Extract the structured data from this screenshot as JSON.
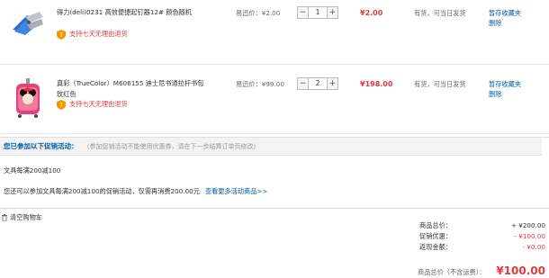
{
  "items": [
    {
      "name": "得力(deli)0231 高效便捷起钉器12# 颜色随机",
      "promise": "支持七天无理由退货",
      "price": "易迅价：¥2.00",
      "quantity": "1",
      "subtotal": "¥2.00",
      "stock": "有货，可当日发货",
      "op_save": "暂存收藏夹",
      "op_delete": "删除"
    },
    {
      "name": "真彩（TrueColor）M606155 迪士尼书通拉杆书包 玫红色",
      "promise": "支持七天无理由退货",
      "price": "易迅价：¥99.00",
      "quantity": "2",
      "subtotal": "¥198.00",
      "stock": "有货，可当日发货",
      "op_save": "暂存收藏夹",
      "op_delete": "删除"
    }
  ],
  "qty_minus": "−",
  "qty_plus": "+",
  "promo": {
    "title": "您已参加以下促销活动：",
    "note": "（参加促销活动不能使用优惠券，请在下一步结算订单页修改）",
    "rule": "文具每满200减100",
    "tip": "您还可以参加文具每满200减100的促销活动，仅需再消费200.00元",
    "link": "查看更多活动商品>>"
  },
  "clear_label": "清空购物车",
  "summary": {
    "lines": [
      {
        "label": "商品总价：",
        "value": "+ ¥200.00"
      },
      {
        "label": "促销优惠：",
        "value": "- ¥100.00"
      },
      {
        "label": "返现金额：",
        "value": "- ¥0.00"
      }
    ],
    "total_label": "商品总价（不含运费）：",
    "total_value": "¥100.00"
  },
  "colors": {
    "accent_red": "#e4393c",
    "link_blue": "#005ea7",
    "promise_orange": "#f39800"
  },
  "icons": [
    "stapler-remover-product-image",
    "minnie-backpack-product-image",
    "shield-icon",
    "trash-icon"
  ]
}
